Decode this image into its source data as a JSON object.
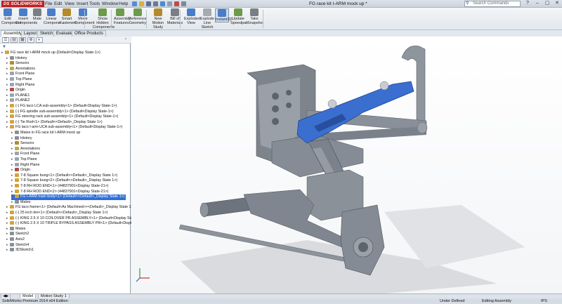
{
  "app": {
    "brand": "SOLIDWORKS",
    "brand_prefix": "DS",
    "title": "FG race kit I-ARM mock up *"
  },
  "menu": [
    "File",
    "Edit",
    "View",
    "Insert",
    "Tools",
    "Window",
    "Help"
  ],
  "search": {
    "placeholder": "Search Commands"
  },
  "window_buttons": [
    "?",
    "–",
    "▢",
    "✕"
  ],
  "ribbon": [
    {
      "label": "Edit Component",
      "icon": "edit-component-icon",
      "color": "#4a7dc9"
    },
    {
      "label": "Insert Components",
      "icon": "insert-components-icon",
      "color": "#4a7dc9"
    },
    {
      "label": "Mate",
      "icon": "mate-icon",
      "color": "#7a7f86"
    },
    {
      "label": "Linear Compone...",
      "icon": "linear-pattern-icon",
      "color": "#4a7dc9"
    },
    {
      "label": "Smart Fasteners",
      "icon": "smart-fasteners-icon",
      "color": "#b58a2a"
    },
    {
      "label": "Move Component",
      "icon": "move-component-icon",
      "color": "#4a7dc9"
    },
    {
      "label": "Show Hidden Components",
      "icon": "show-hidden-icon",
      "color": "#6c9c4a"
    },
    {
      "label": "Assembly Features",
      "icon": "assembly-features-icon",
      "color": "#6c9c4a"
    },
    {
      "label": "Reference Geometry",
      "icon": "reference-geometry-icon",
      "color": "#6c9c4a"
    },
    {
      "label": "New Motion Study",
      "icon": "motion-study-icon",
      "color": "#b58a2a"
    },
    {
      "label": "Bill of Materials",
      "icon": "bom-icon",
      "color": "#7a7f86"
    },
    {
      "label": "Exploded View",
      "icon": "exploded-view-icon",
      "color": "#4a7dc9"
    },
    {
      "label": "Explode Line Sketch",
      "icon": "explode-line-icon",
      "color": "#a7abb0"
    },
    {
      "label": "Instant3D",
      "icon": "instant3d-icon",
      "color": "#4a7dc9"
    },
    {
      "label": "Update Speedpak",
      "icon": "speedpak-icon",
      "color": "#6c9c4a"
    },
    {
      "label": "Take Snapshot",
      "icon": "snapshot-icon",
      "color": "#7a7f86"
    }
  ],
  "command_tabs": [
    "Assembly",
    "Layout",
    "Sketch",
    "Evaluate",
    "Office Products"
  ],
  "tree": [
    {
      "label": "FG race kit I-ARM mock up  (Default<Display State-1>)",
      "icon": "assembly-icon",
      "color": "#d3a23a",
      "indent": 0
    },
    {
      "label": "History",
      "icon": "history-icon",
      "color": "#8a8f96",
      "indent": 1
    },
    {
      "label": "Sensors",
      "icon": "sensor-icon",
      "color": "#b58a2a",
      "indent": 1
    },
    {
      "label": "Annotations",
      "icon": "annotation-icon",
      "color": "#c2a64a",
      "indent": 1
    },
    {
      "label": "Front Plane",
      "icon": "plane-icon",
      "color": "#9aa4af",
      "indent": 1
    },
    {
      "label": "Top Plane",
      "icon": "plane-icon",
      "color": "#9aa4af",
      "indent": 1
    },
    {
      "label": "Right Plane",
      "icon": "plane-icon",
      "color": "#9aa4af",
      "indent": 1
    },
    {
      "label": "Origin",
      "icon": "origin-icon",
      "color": "#b04a4a",
      "indent": 1
    },
    {
      "label": "PLANE1",
      "icon": "plane-icon",
      "color": "#9aa4af",
      "indent": 1
    },
    {
      "label": "PLANE2",
      "icon": "plane-icon",
      "color": "#9aa4af",
      "indent": 1
    },
    {
      "label": "(-) FG taco LCA sub-assembly<1> (Default<Display State-1>)",
      "icon": "subassembly-icon",
      "color": "#d3a23a",
      "indent": 1
    },
    {
      "label": "(-) FG spindle sub-assembly<1> (Default<Display State-1>)",
      "icon": "subassembly-icon",
      "color": "#d3a23a",
      "indent": 1
    },
    {
      "label": "FG steering rack sub-assembly<1> (Default<Display State-1>)",
      "icon": "subassembly-icon",
      "color": "#d3a23a",
      "indent": 1
    },
    {
      "label": "(-) Tie Rod<1> (Default<<Default>_Display State 1>)",
      "icon": "part-icon",
      "color": "#d3a23a",
      "indent": 1
    },
    {
      "label": "FG taco I-arm UCA sub-assembly<1> (Default<Display State-1>)",
      "icon": "subassembly-icon",
      "color": "#d3a23a",
      "indent": 1
    },
    {
      "label": "Mates in FG race kit I-ARM mock up",
      "icon": "mates-icon",
      "color": "#8a8f96",
      "indent": 2
    },
    {
      "label": "History",
      "icon": "history-icon",
      "color": "#8a8f96",
      "indent": 2
    },
    {
      "label": "Sensors",
      "icon": "sensor-icon",
      "color": "#b58a2a",
      "indent": 2
    },
    {
      "label": "Annotations",
      "icon": "annotation-icon",
      "color": "#c2a64a",
      "indent": 2
    },
    {
      "label": "Front Plane",
      "icon": "plane-icon",
      "color": "#9aa4af",
      "indent": 2
    },
    {
      "label": "Top Plane",
      "icon": "plane-icon",
      "color": "#9aa4af",
      "indent": 2
    },
    {
      "label": "Right Plane",
      "icon": "plane-icon",
      "color": "#9aa4af",
      "indent": 2
    },
    {
      "label": "Origin",
      "icon": "origin-icon",
      "color": "#b04a4a",
      "indent": 2
    },
    {
      "label": "7-8 Square bung<1> (Default<<Default>_Display State 1>)",
      "icon": "part-icon",
      "color": "#d3a23a",
      "indent": 2
    },
    {
      "label": "7-8 Square bung<2> (Default<<Default>_Display State 1>)",
      "icon": "part-icon",
      "color": "#d3a23a",
      "indent": 2
    },
    {
      "label": "7-8 RH ROD END<1> (44837901<Display State-21>)",
      "icon": "part-icon",
      "color": "#d3a23a",
      "indent": 2
    },
    {
      "label": "7-8 RH ROD END<2> (44837901<Display State-21>)",
      "icon": "part-icon",
      "color": "#d3a23a",
      "indent": 2
    },
    {
      "label": "FG I-ARM main body<1> (Default<<Default>_Display State 1>)",
      "icon": "part-icon",
      "color": "#d3a23a",
      "indent": 2,
      "selected": true
    },
    {
      "label": "Mates",
      "icon": "mates-icon",
      "color": "#8a8f96",
      "indent": 2
    },
    {
      "label": "FG taco frame<1> (Default<As Machined>><Default>_Display State 1>)",
      "icon": "part-icon",
      "color": "#d3a23a",
      "indent": 1
    },
    {
      "label": "(-) 25 inch tire<1> (Default<<Default>_Display State 1>)",
      "icon": "part-icon",
      "color": "#d3a23a",
      "indent": 1
    },
    {
      "label": "(-) KING 2.5 X 10 COILOVER PR ASSEMBLY<1> (Default<Display State-1>)",
      "icon": "subassembly-icon",
      "color": "#d3a23a",
      "indent": 1
    },
    {
      "label": "(-) KING 2.5 X 10 TRIPLE BYPASS ASSEMBLY PR<1> (Default<Display State-1>)",
      "icon": "subassembly-icon",
      "color": "#d3a23a",
      "indent": 1
    },
    {
      "label": "Mates",
      "icon": "mates-icon",
      "color": "#8a8f96",
      "indent": 1
    },
    {
      "label": "Sketch2",
      "icon": "sketch-icon",
      "color": "#8a8f96",
      "indent": 1
    },
    {
      "label": "Axis2",
      "icon": "axis-icon",
      "color": "#8a8f96",
      "indent": 1
    },
    {
      "label": "Sketch4",
      "icon": "sketch-icon",
      "color": "#8a8f96",
      "indent": 1
    },
    {
      "label": "3DSketch1",
      "icon": "sketch-icon",
      "color": "#8a8f96",
      "indent": 1
    }
  ],
  "bottom_tabs": [
    "Model",
    "Motion Study 1"
  ],
  "status": {
    "edition": "SolidWorks Premium 2014 x64 Edition",
    "state": "Under Defined",
    "mode": "Editing Assembly",
    "units": "IPS"
  },
  "colors": {
    "accent": "#2f6fd8",
    "model_gray": "#8d939c",
    "model_blue": "#3a6fd0",
    "brand_red": "#c21f1f"
  }
}
